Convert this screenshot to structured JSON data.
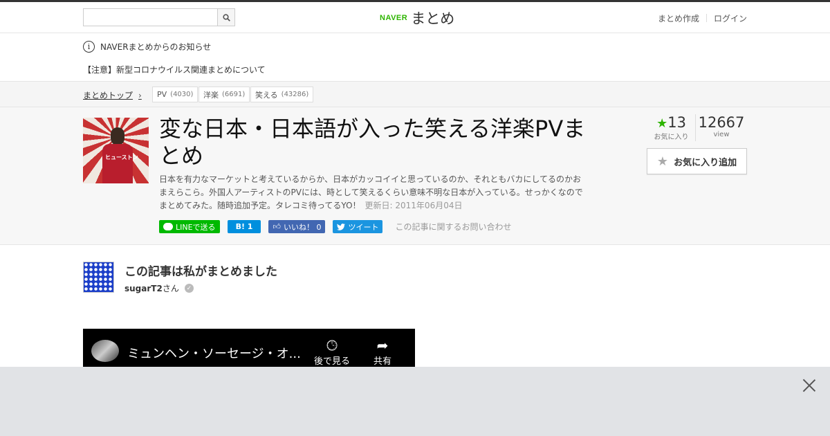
{
  "header": {
    "search": {
      "placeholder": ""
    },
    "logo": {
      "brand": "NAVER",
      "name": "まとめ"
    },
    "links": [
      {
        "label": "まとめ作成"
      },
      {
        "label": "ログイン"
      }
    ]
  },
  "notice": {
    "title": "NAVERまとめからのお知らせ",
    "item": "【注意】新型コロナウイルス関連まとめについて"
  },
  "breadcrumb": {
    "top": "まとめトップ",
    "tags": [
      {
        "label": "PV",
        "count": "(4030)"
      },
      {
        "label": "洋楽",
        "count": "(6691)"
      },
      {
        "label": "笑える",
        "count": "(43286)"
      }
    ]
  },
  "article": {
    "thumb_text": "ヒューストン",
    "title": "変な日本・日本語が入った笑える洋楽PVまとめ",
    "description": "日本を有力なマーケットと考えているからか、日本がカッコイイと思っているのか、それともバカにしてるのかおまえらこら。外国人アーティストのPVには、時として笑えるくらい意味不明な日本が入っている。せっかくなのでまとめてみた。随時追加予定。タレコミ待ってるYO！",
    "updated": "更新日: 2011年06月04日",
    "favorites": "13",
    "favorites_label": "お気に入り",
    "views": "12667",
    "views_label": "view",
    "fav_button": "お気に入り追加",
    "share": {
      "line": "LINEで送る",
      "hatena": "B! 1",
      "facebook": "いいね！ 0",
      "twitter": "ツイート"
    },
    "inquiry": "この記事に関するお問い合わせ"
  },
  "author": {
    "heading": "この記事は私がまとめました",
    "name": "sugarT2",
    "suffix": "さん"
  },
  "video": {
    "title": "ミュンヘン・ソーセージ・オ...",
    "watch_later": "後で見る",
    "share": "共有"
  },
  "colors": {
    "naver_green": "#2db400",
    "ad_bar": "#e1e3e6"
  }
}
